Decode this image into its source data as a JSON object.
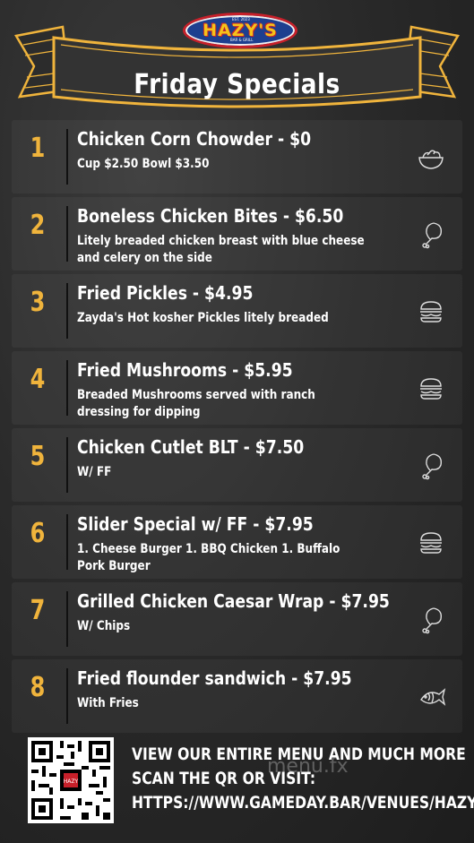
{
  "logo": {
    "text": "HAZY'S",
    "sub_left": "EST. 2023",
    "sub_right": "BAR & GRILL"
  },
  "title": "Friday Specials",
  "items": [
    {
      "number": "1",
      "name": "Chicken Corn Chowder  - $0",
      "desc": "Cup $2.50 Bowl $3.50",
      "icon": "salad-bowl-icon"
    },
    {
      "number": "2",
      "name": "Boneless Chicken Bites  - $6.50",
      "desc": "Litely breaded chicken breast with blue cheese and celery on the side",
      "icon": "chicken-leg-icon"
    },
    {
      "number": "3",
      "name": "Fried Pickles - $4.95",
      "desc": "Zayda's Hot kosher Pickles litely breaded",
      "icon": "burger-icon"
    },
    {
      "number": "4",
      "name": "Fried Mushrooms  - $5.95",
      "desc": "Breaded Mushrooms served with ranch dressing for dipping",
      "icon": "burger-icon"
    },
    {
      "number": "5",
      "name": "Chicken Cutlet BLT  - $7.50",
      "desc": "W/ FF",
      "icon": "chicken-leg-icon"
    },
    {
      "number": "6",
      "name": "Slider Special w/ FF - $7.95",
      "desc": "1. Cheese Burger 1. BBQ Chicken  1. Buffalo Pork Burger",
      "icon": "burger-icon"
    },
    {
      "number": "7",
      "name": "Grilled Chicken Caesar Wrap - $7.95",
      "desc": "W/ Chips",
      "icon": "chicken-leg-icon"
    },
    {
      "number": "8",
      "name": "Fried flounder sandwich  - $7.95",
      "desc": "With Fries",
      "icon": "fish-icon"
    }
  ],
  "footer": {
    "line1": "View our entire menu and much more",
    "line2": "scan the QR or visit:",
    "line3": "https://www.gameday.bar/venues/hazy",
    "qr_label": "HAZY"
  },
  "watermark": "menu.fx",
  "colors": {
    "background": "#2a2a2a",
    "number": "#f0b43c",
    "banner": "#f0b43c",
    "text": "#ffffff"
  }
}
